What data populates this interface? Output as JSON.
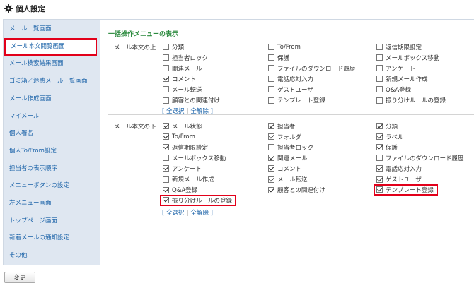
{
  "header": {
    "title": "個人設定"
  },
  "sidebar": {
    "items": [
      {
        "label": "メール一覧画面",
        "active": false
      },
      {
        "label": "メール本文閲覧画面",
        "active": true
      },
      {
        "label": "メール検索結果画面",
        "active": false
      },
      {
        "label": "ゴミ箱／迷惑メール一覧画面",
        "active": false
      },
      {
        "label": "メール作成画面",
        "active": false
      },
      {
        "label": "マイメール",
        "active": false
      },
      {
        "label": "個人署名",
        "active": false
      },
      {
        "label": "個人To/From設定",
        "active": false
      },
      {
        "label": "担当者の表示順序",
        "active": false
      },
      {
        "label": "メニューボタンの設定",
        "active": false
      },
      {
        "label": "左メニュー画面",
        "active": false
      },
      {
        "label": "トップページ画面",
        "active": false
      },
      {
        "label": "新着メールの通知設定",
        "active": false
      },
      {
        "label": "その他",
        "active": false
      }
    ]
  },
  "main": {
    "section_title": "一括操作メニューの表示",
    "select_all": "全選択",
    "deselect_all": "全解除",
    "bracket_open": "[",
    "bracket_close": "]",
    "separator": "|",
    "top_group": {
      "label": "メール本文の上",
      "columns": [
        [
          {
            "label": "分類",
            "checked": false
          },
          {
            "label": "担当者ロック",
            "checked": false
          },
          {
            "label": "関連メール",
            "checked": false
          },
          {
            "label": "コメント",
            "checked": true
          },
          {
            "label": "メール転送",
            "checked": false
          },
          {
            "label": "顧客との関連付け",
            "checked": false
          }
        ],
        [
          {
            "label": "To/From",
            "checked": false
          },
          {
            "label": "保護",
            "checked": false
          },
          {
            "label": "ファイルのダウンロード履歴",
            "checked": false
          },
          {
            "label": "電話応対入力",
            "checked": false
          },
          {
            "label": "ゲストユーザ",
            "checked": false
          },
          {
            "label": "テンプレート登録",
            "checked": false
          }
        ],
        [
          {
            "label": "返信期限設定",
            "checked": false
          },
          {
            "label": "メールボックス移動",
            "checked": false
          },
          {
            "label": "アンケート",
            "checked": false
          },
          {
            "label": "新規メール作成",
            "checked": false
          },
          {
            "label": "Q&A登録",
            "checked": false
          },
          {
            "label": "振り分けルールの登録",
            "checked": false
          }
        ]
      ]
    },
    "bottom_group": {
      "label": "メール本文の下",
      "columns": [
        [
          {
            "label": "メール状態",
            "checked": true
          },
          {
            "label": "To/From",
            "checked": true
          },
          {
            "label": "返信期限設定",
            "checked": true
          },
          {
            "label": "メールボックス移動",
            "checked": false
          },
          {
            "label": "アンケート",
            "checked": true
          },
          {
            "label": "新規メール作成",
            "checked": false
          },
          {
            "label": "Q&A登録",
            "checked": true
          },
          {
            "label": "振り分けルールの登録",
            "checked": true,
            "highlight": true
          }
        ],
        [
          {
            "label": "担当者",
            "checked": true
          },
          {
            "label": "フォルダ",
            "checked": true
          },
          {
            "label": "担当者ロック",
            "checked": false
          },
          {
            "label": "関連メール",
            "checked": true
          },
          {
            "label": "コメント",
            "checked": true
          },
          {
            "label": "メール転送",
            "checked": true
          },
          {
            "label": "顧客との関連付け",
            "checked": true
          }
        ],
        [
          {
            "label": "分類",
            "checked": true
          },
          {
            "label": "ラベル",
            "checked": true
          },
          {
            "label": "保護",
            "checked": true
          },
          {
            "label": "ファイルのダウンロード履歴",
            "checked": false
          },
          {
            "label": "電話応対入力",
            "checked": true
          },
          {
            "label": "ゲストユーザ",
            "checked": true
          },
          {
            "label": "テンプレート登録",
            "checked": true,
            "highlight": true
          }
        ]
      ]
    }
  },
  "footer": {
    "change_button": "変更"
  },
  "colors": {
    "accent_red": "#e2001a",
    "link_blue": "#1a62a8",
    "section_green": "#2b8a3e",
    "sidebar_bg": "#dfe7f1"
  }
}
